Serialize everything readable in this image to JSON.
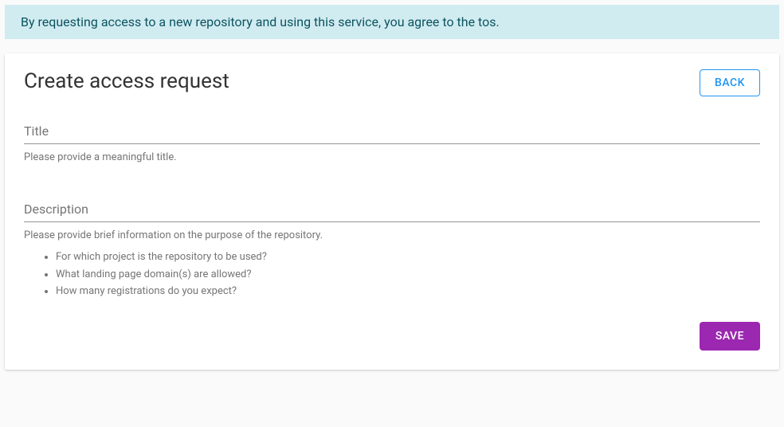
{
  "banner": {
    "text": "By requesting access to a new repository and using this service, you agree to the tos."
  },
  "header": {
    "title": "Create access request",
    "back_label": "BACK"
  },
  "form": {
    "title": {
      "placeholder": "Title",
      "value": "",
      "helper": "Please provide a meaningful title."
    },
    "description": {
      "placeholder": "Description",
      "value": "",
      "helper": "Please provide brief information on the purpose of the repository.",
      "bullets": [
        "For which project is the repository to be used?",
        "What landing page domain(s) are allowed?",
        "How many registrations do you expect?"
      ]
    }
  },
  "actions": {
    "save_label": "SAVE"
  }
}
